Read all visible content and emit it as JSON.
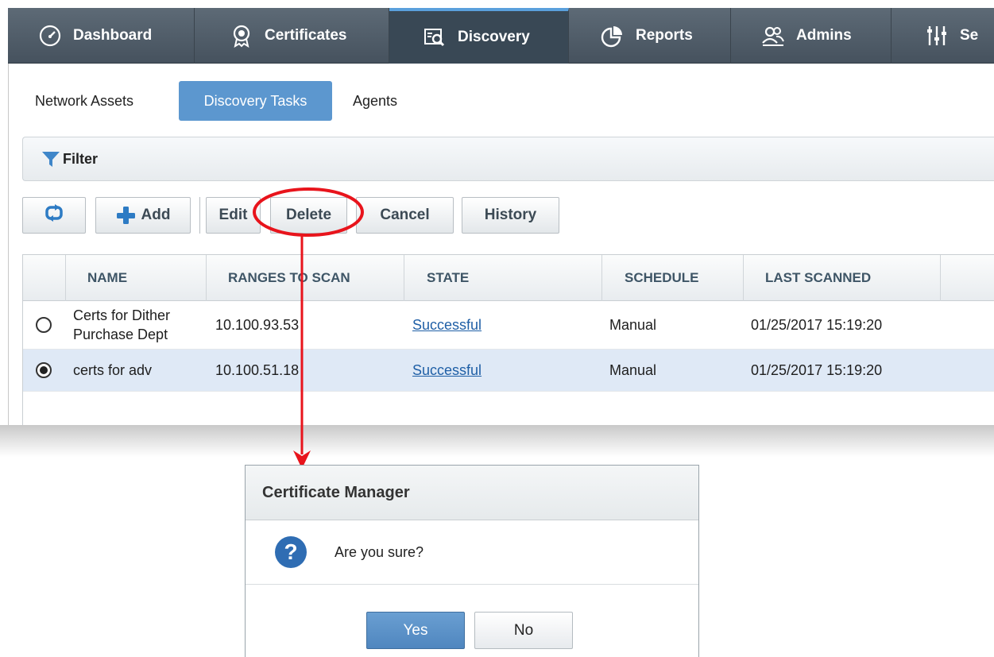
{
  "nav": {
    "tabs": [
      {
        "label": "Dashboard",
        "icon": "dashboard-gauge-icon"
      },
      {
        "label": "Certificates",
        "icon": "certificate-badge-icon"
      },
      {
        "label": "Discovery",
        "icon": "discovery-icon",
        "active": true
      },
      {
        "label": "Reports",
        "icon": "reports-pie-icon"
      },
      {
        "label": "Admins",
        "icon": "admins-users-icon"
      },
      {
        "label": "Se",
        "icon": "settings-sliders-icon"
      }
    ]
  },
  "subtabs": {
    "network_assets": "Network Assets",
    "discovery_tasks": "Discovery Tasks",
    "agents": "Agents",
    "active": "Discovery Tasks"
  },
  "filter": {
    "label": "Filter",
    "icon": "funnel-icon"
  },
  "toolbar": {
    "refresh_icon": "refresh-icon",
    "add": "Add",
    "edit": "Edit",
    "delete": "Delete",
    "cancel": "Cancel",
    "history": "History"
  },
  "table": {
    "columns": [
      "NAME",
      "RANGES TO SCAN",
      "STATE",
      "SCHEDULE",
      "LAST SCANNED"
    ],
    "rows": [
      {
        "name_line1": "Certs for Dither",
        "name_line2": "Purchase Dept",
        "ranges": "10.100.93.53",
        "state": "Successful",
        "schedule": "Manual",
        "last_scanned": "01/25/2017 15:19:20",
        "selected": false
      },
      {
        "name_line1": "certs for adv",
        "name_line2": "",
        "ranges": "10.100.51.18",
        "state": "Successful",
        "schedule": "Manual",
        "last_scanned": "01/25/2017 15:19:20",
        "selected": true
      }
    ]
  },
  "dialog": {
    "title": "Certificate Manager",
    "message": "Are you sure?",
    "icon": "question-icon",
    "yes": "Yes",
    "no": "No"
  },
  "colors": {
    "nav_bg": "#4f5b67",
    "accent": "#5c97cf",
    "annotation": "#e8141c",
    "selected_row": "#dfe9f6",
    "link": "#1f5fa6"
  }
}
